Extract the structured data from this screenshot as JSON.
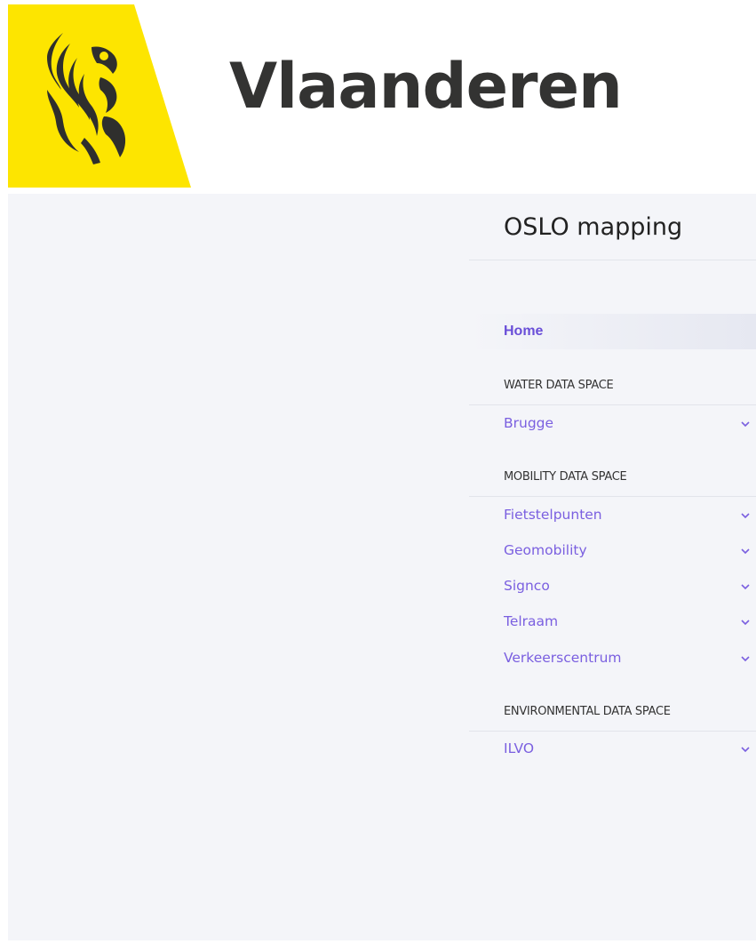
{
  "header": {
    "brand": "Vlaanderen",
    "logo_icon": "flemish-lion-icon",
    "logo_color": "#fde500"
  },
  "sidebar": {
    "title": "OSLO mapping",
    "home_label": "Home",
    "accent_color": "#7a5fe0",
    "sections": [
      {
        "heading": "WATER DATA SPACE",
        "items": [
          {
            "label": "Brugge",
            "icon": "chevron-down-icon"
          }
        ]
      },
      {
        "heading": "MOBILITY DATA SPACE",
        "items": [
          {
            "label": "Fietstelpunten",
            "icon": "chevron-down-icon"
          },
          {
            "label": "Geomobility",
            "icon": "chevron-down-icon"
          },
          {
            "label": "Signco",
            "icon": "chevron-down-icon"
          },
          {
            "label": "Telraam",
            "icon": "chevron-down-icon"
          },
          {
            "label": "Verkeerscentrum",
            "icon": "chevron-down-icon"
          }
        ]
      },
      {
        "heading": "ENVIRONMENTAL DATA SPACE",
        "items": [
          {
            "label": "ILVO",
            "icon": "chevron-down-icon"
          }
        ]
      }
    ]
  }
}
